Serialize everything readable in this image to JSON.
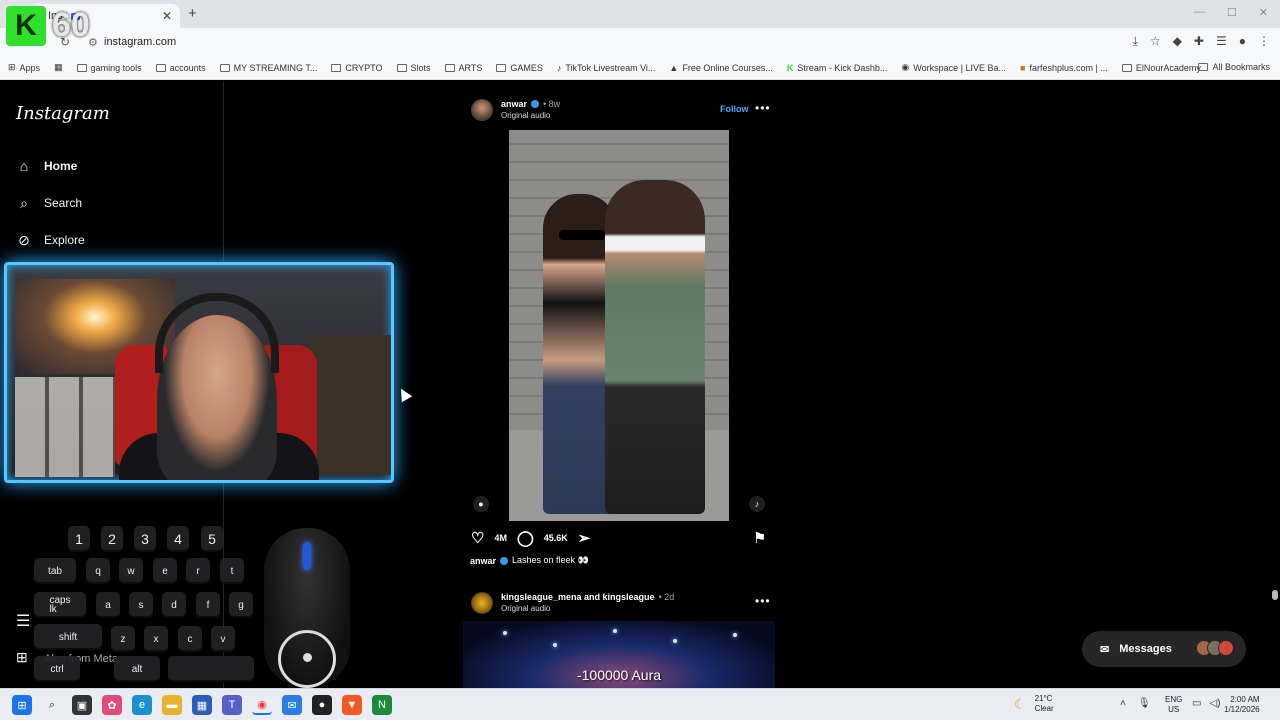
{
  "browser": {
    "tab_title": "Ins",
    "url": "instagram.com",
    "bookmarks": [
      "Apps",
      "gaming tools",
      "accounts",
      "MY STREAMING T...",
      "CRYPTO",
      "Slots",
      "ARTS",
      "GAMES",
      "TikTok Livestream Vi...",
      "Free Online Courses...",
      "Stream - Kick Dashb...",
      "Workspace | LIVE Ba...",
      "farfeshplus.com | ...",
      "ElNourAcademy"
    ],
    "all_bookmarks": "All Bookmarks"
  },
  "overlay": {
    "brand_letter": "K",
    "badge_number": "60"
  },
  "sidebar": {
    "logo": "Instagram",
    "items": [
      {
        "label": "Home",
        "icon": "home-icon"
      },
      {
        "label": "Search",
        "icon": "search-icon"
      },
      {
        "label": "Explore",
        "icon": "compass-icon"
      }
    ],
    "also_from_meta": "Also from Meta"
  },
  "keyboard": {
    "numbers": [
      "1",
      "2",
      "3",
      "4",
      "5"
    ],
    "row1": [
      "tab",
      "q",
      "w",
      "e",
      "r",
      "t"
    ],
    "row2": [
      "caps\nlk",
      "a",
      "s",
      "d",
      "f",
      "g"
    ],
    "row3": [
      "shift",
      "z",
      "x",
      "c",
      "v"
    ],
    "row4": [
      "ctrl",
      "alt"
    ]
  },
  "post1": {
    "username": "anwar",
    "time": "8w",
    "audio": "Original audio",
    "follow": "Follow",
    "likes": "4M",
    "comments": "45.6K",
    "caption_user": "anwar",
    "caption_text": "Lashes on fleek 👀"
  },
  "post2": {
    "users": "kingsleague_mena and kingsleague",
    "time": "2d",
    "audio": "Original audio",
    "subtitle": "-100000 Aura"
  },
  "messages": {
    "label": "Messages"
  },
  "taskbar": {
    "temp": "21°C",
    "condition": "Clear",
    "lang1": "ENG",
    "lang2": "US",
    "time": "2:00 AM",
    "date": "1/12/2026"
  },
  "colors": {
    "follow": "#4aa3ff",
    "verified": "#3897f0",
    "cam_glow": "#55c8ff",
    "kick_green": "#2fe12a"
  }
}
